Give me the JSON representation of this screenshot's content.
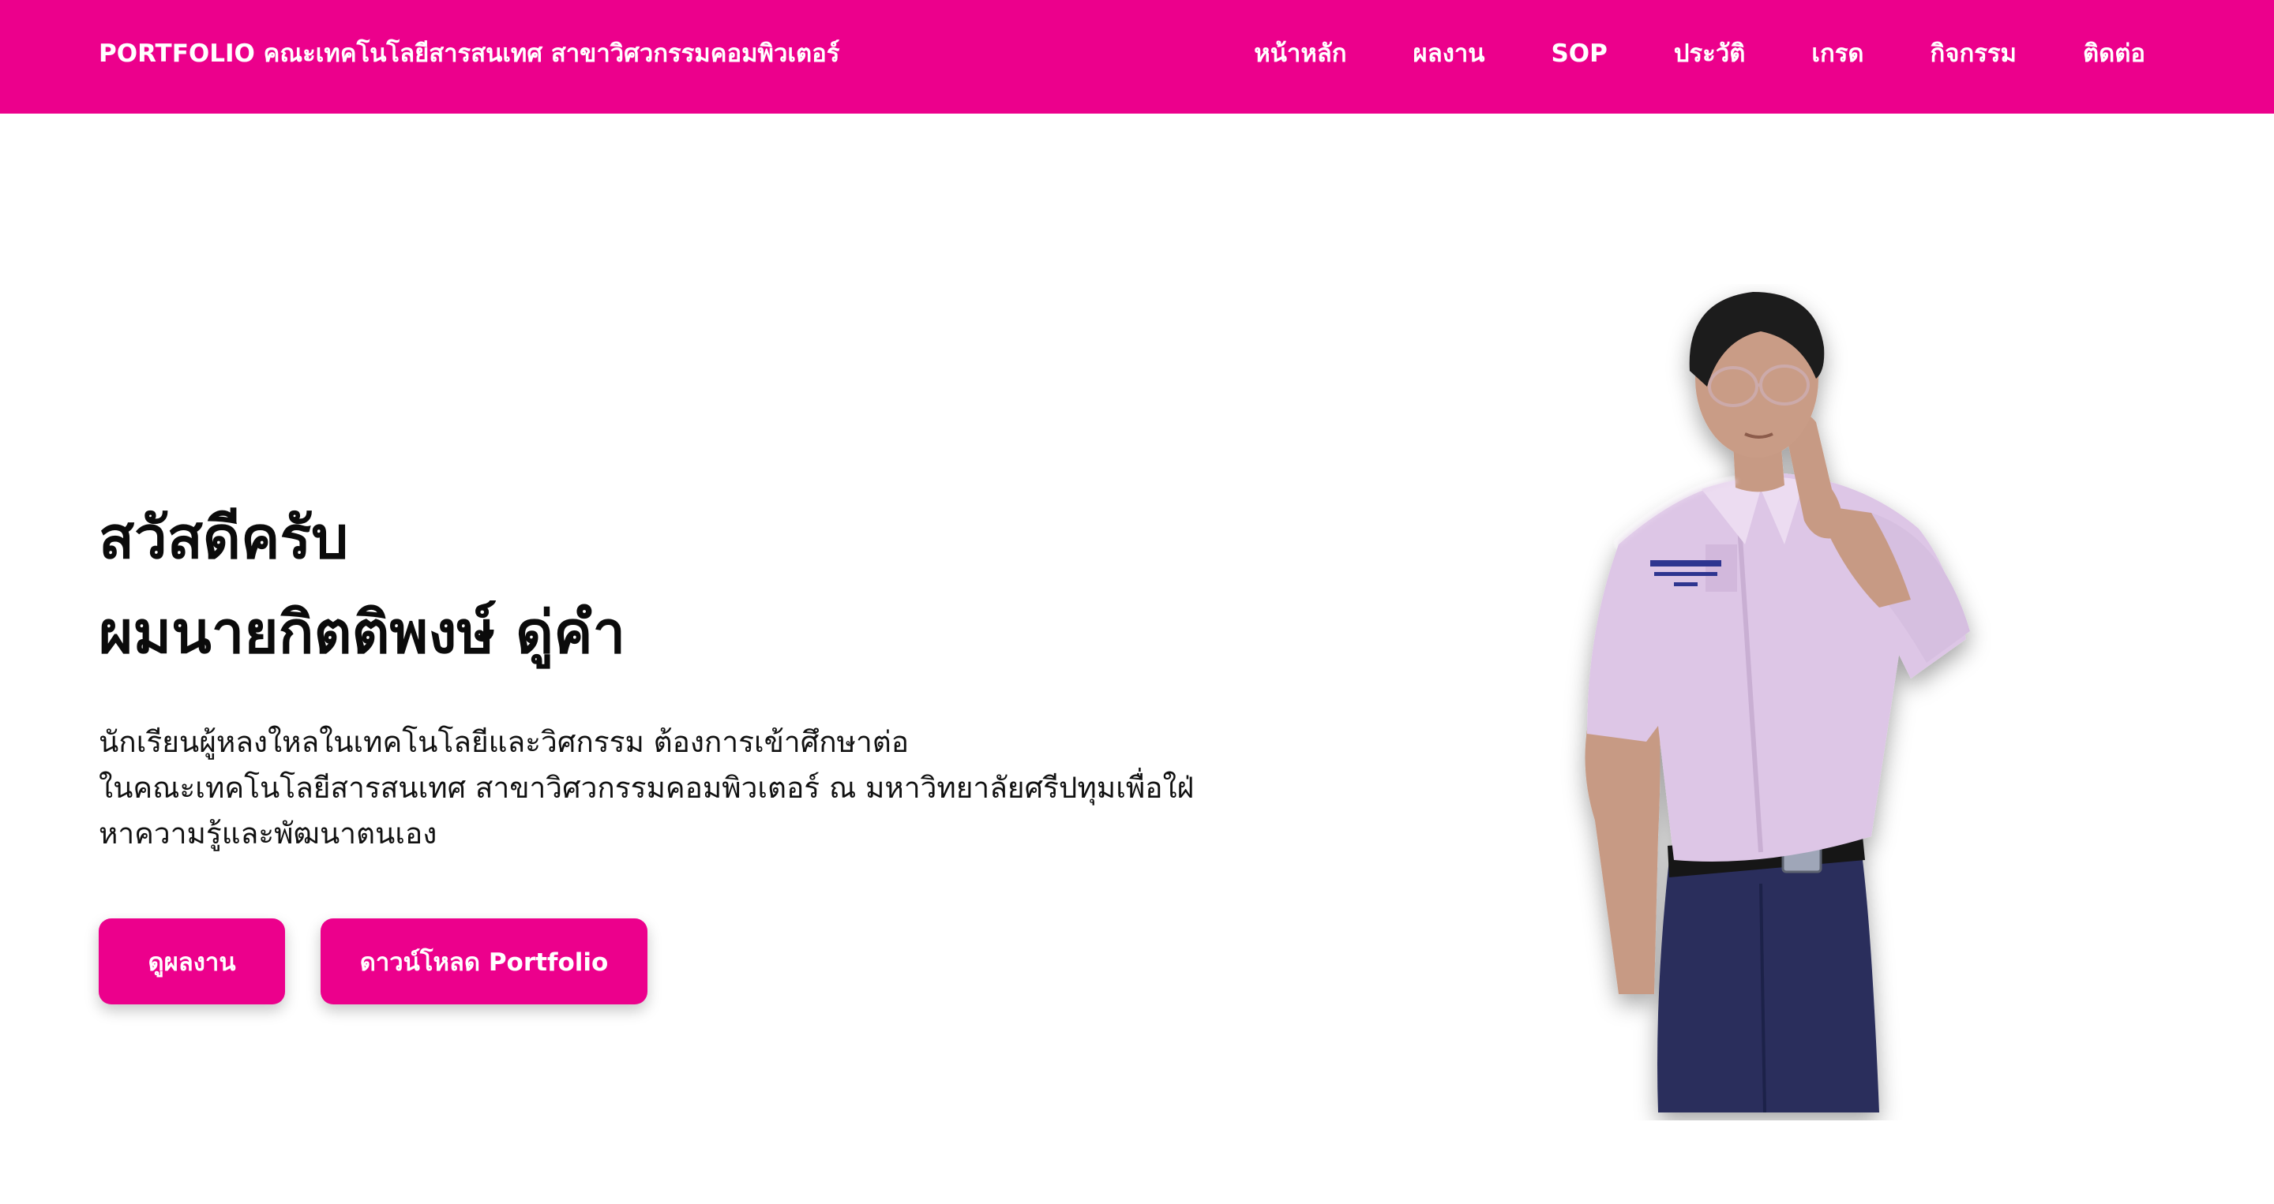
{
  "header": {
    "brand": "PORTFOLIO คณะเทคโนโลยีสารสนเทศ สาขาวิศวกรรมคอมพิวเตอร์",
    "nav": [
      {
        "label": "หน้าหลัก"
      },
      {
        "label": "ผลงาน"
      },
      {
        "label": "SOP"
      },
      {
        "label": "ประวัติ"
      },
      {
        "label": "เกรด"
      },
      {
        "label": "กิจกรรม"
      },
      {
        "label": "ติดต่อ"
      }
    ]
  },
  "hero": {
    "title_line1": "สวัสดีครับ",
    "title_line2": "ผมนายกิตติพงษ์ ดู่คำ",
    "desc_line1": "นักเรียนผู้หลงใหลในเทคโนโลยีและวิศกรรม ต้องการเข้าศึกษาต่อ",
    "desc_line2": "ในคณะเทคโนโลยีสารสนเทศ สาขาวิศวกรรมคอมพิวเตอร์ ณ มหาวิทยาลัยศรีปทุมเพื่อใฝ่",
    "desc_line3": "หาความรู้และพัฒนาตนเอง",
    "btn_works": "ดูผลงาน",
    "btn_download": "ดาวน์โหลด Portfolio"
  },
  "colors": {
    "accent": "#ec008c",
    "background": "#ffffff",
    "text": "#111111"
  },
  "icons": {
    "profile_photo": "student-portrait-photo"
  }
}
